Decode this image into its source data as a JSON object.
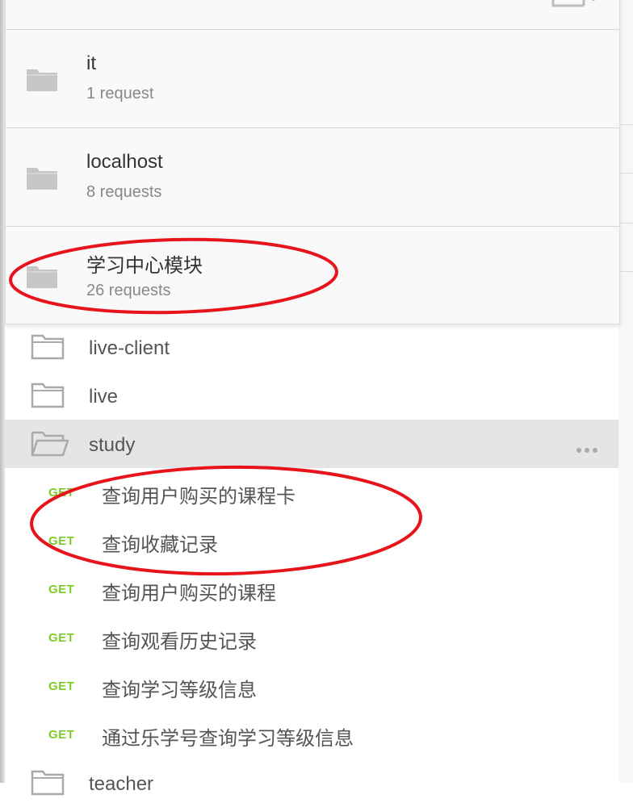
{
  "collections": [
    {
      "name": "it",
      "count": "1 request"
    },
    {
      "name": "localhost",
      "count": "8 requests"
    },
    {
      "name": "学习中心模块",
      "count": "26 requests"
    }
  ],
  "folders": {
    "live_client": "live-client",
    "live": "live",
    "study": "study",
    "teacher": "teacher"
  },
  "requests": [
    {
      "method": "GET",
      "name": "查询用户购买的课程卡"
    },
    {
      "method": "GET",
      "name": "查询收藏记录"
    },
    {
      "method": "GET",
      "name": "查询用户购买的课程"
    },
    {
      "method": "GET",
      "name": "查询观看历史记录"
    },
    {
      "method": "GET",
      "name": "查询学习等级信息"
    },
    {
      "method": "GET",
      "name": "通过乐学号查询学习等级信息"
    }
  ],
  "icons": {
    "new_collection": "new-collection-icon",
    "collection": "collection-folder-icon",
    "folder": "folder-outline-icon",
    "folder_open": "folder-open-icon",
    "more": "more-options-icon"
  },
  "colors": {
    "get_method": "#7bcc29",
    "annotation": "#e8141b",
    "active_row": "#e5e5e5"
  }
}
